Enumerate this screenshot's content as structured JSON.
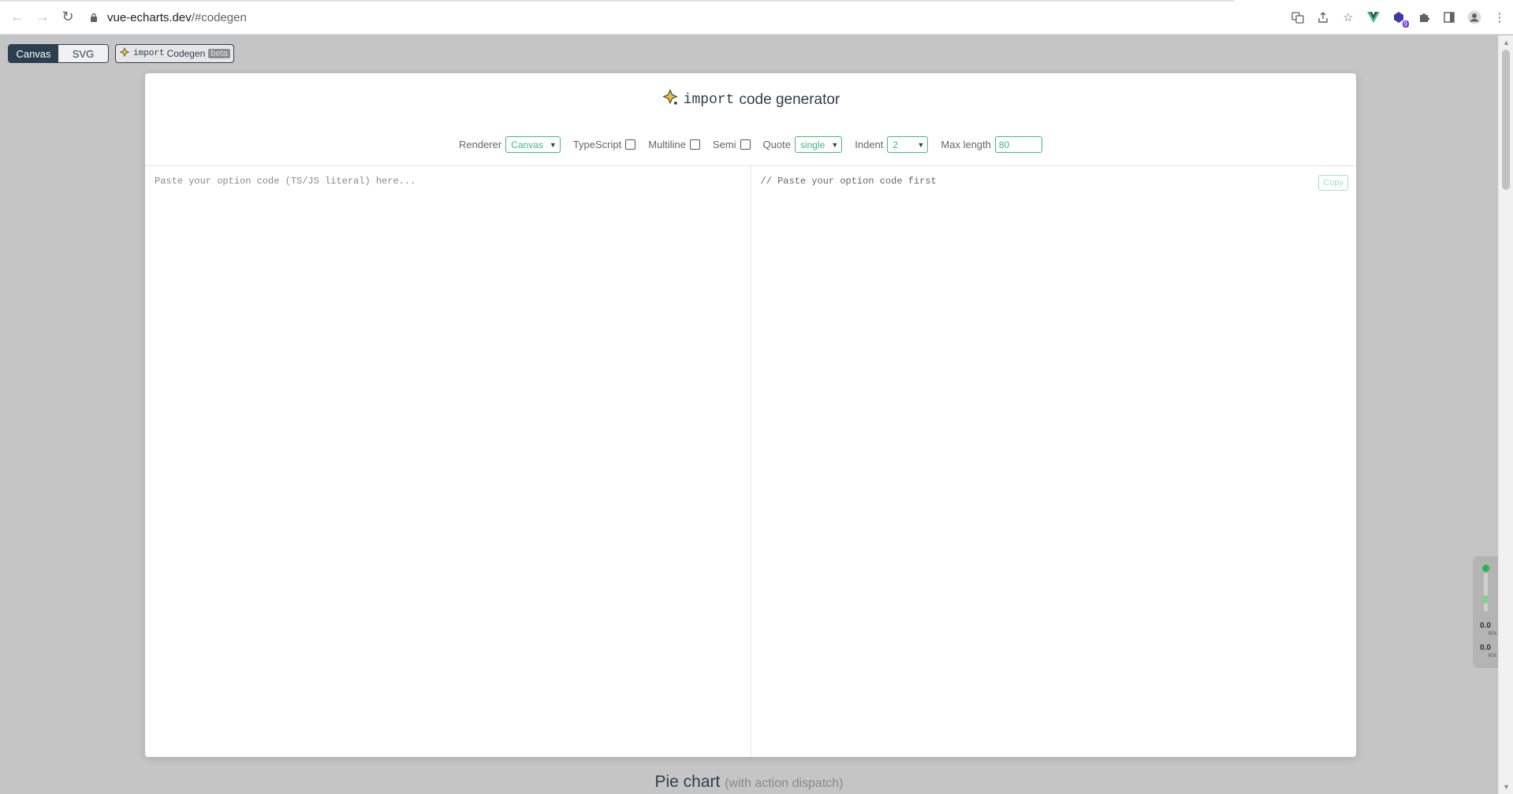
{
  "browser": {
    "url_host": "vue-echarts.dev",
    "url_path": "/#codegen",
    "extension_badge": "9"
  },
  "renderer_toggle": {
    "options": [
      "Canvas",
      "SVG"
    ],
    "selected": "Canvas"
  },
  "codegen_button": {
    "code_word": "import",
    "label": "Codegen",
    "badge": "beta"
  },
  "modal": {
    "title_code": "import",
    "title_text": "code generator",
    "options": {
      "renderer_label": "Renderer",
      "renderer_value": "Canvas",
      "typescript_label": "TypeScript",
      "multiline_label": "Multiline",
      "semi_label": "Semi",
      "quote_label": "Quote",
      "quote_value": "single",
      "indent_label": "Indent",
      "indent_value": "2",
      "maxlength_label": "Max length",
      "maxlength_value": "80"
    },
    "input_placeholder": "Paste your option code (TS/JS literal) here...",
    "output_text": "// Paste your option code first",
    "copy_label": "Copy"
  },
  "section": {
    "title": "Pie chart",
    "subtitle": "(with action dispatch)"
  },
  "netmon": {
    "down": "0.0",
    "down_unit": "K/s",
    "up": "0.0",
    "up_unit": "K/s"
  },
  "colors": {
    "accent": "#42b883",
    "dark": "#2c3e50",
    "backdrop": "#c5c5c5"
  }
}
